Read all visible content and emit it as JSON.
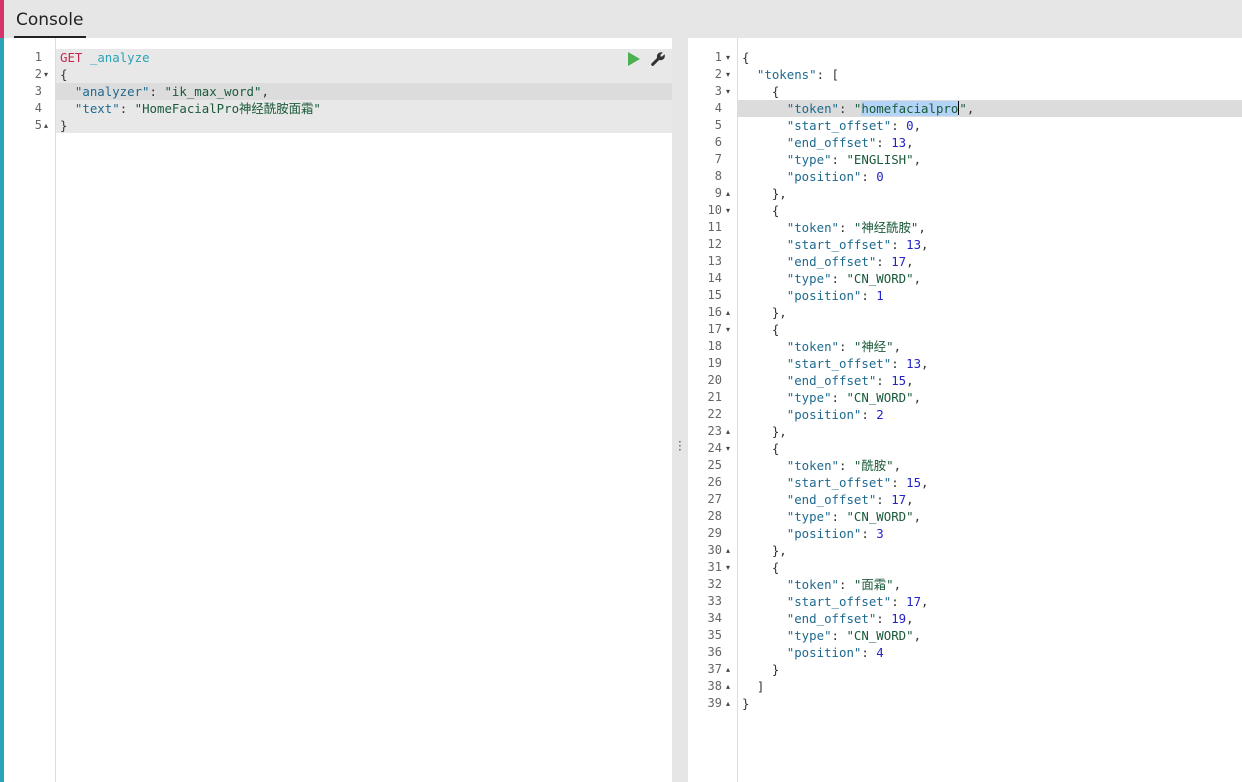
{
  "header": {
    "tab_label": "Console"
  },
  "colors": {
    "accent": "#2aa3b7",
    "method": "#c7254e",
    "play": "#4caf50"
  },
  "request": {
    "method": "GET",
    "endpoint": "_analyze",
    "line_numbers": [
      "1",
      "2",
      "3",
      "4",
      "5"
    ],
    "body": {
      "analyzer_key": "\"analyzer\"",
      "analyzer_value": "\"ik_max_word\"",
      "text_key": "\"text\"",
      "text_value": "\"HomeFacialPro神经酰胺面霜\""
    }
  },
  "response": {
    "line_numbers": [
      "1",
      "2",
      "3",
      "4",
      "5",
      "6",
      "7",
      "8",
      "9",
      "10",
      "11",
      "12",
      "13",
      "14",
      "15",
      "16",
      "17",
      "18",
      "19",
      "20",
      "21",
      "22",
      "23",
      "24",
      "25",
      "26",
      "27",
      "28",
      "29",
      "30",
      "31",
      "32",
      "33",
      "34",
      "35",
      "36",
      "37",
      "38",
      "39"
    ],
    "tokens_key": "\"tokens\"",
    "tokens": [
      {
        "token": "\"homefacialpro\"",
        "start_offset": "0",
        "end_offset": "13",
        "type": "\"ENGLISH\"",
        "position": "0"
      },
      {
        "token": "\"神经酰胺\"",
        "start_offset": "13",
        "end_offset": "17",
        "type": "\"CN_WORD\"",
        "position": "1"
      },
      {
        "token": "\"神经\"",
        "start_offset": "13",
        "end_offset": "15",
        "type": "\"CN_WORD\"",
        "position": "2"
      },
      {
        "token": "\"酰胺\"",
        "start_offset": "15",
        "end_offset": "17",
        "type": "\"CN_WORD\"",
        "position": "3"
      },
      {
        "token": "\"面霜\"",
        "start_offset": "17",
        "end_offset": "19",
        "type": "\"CN_WORD\"",
        "position": "4"
      }
    ],
    "keys": {
      "token": "\"token\"",
      "start_offset": "\"start_offset\"",
      "end_offset": "\"end_offset\"",
      "type": "\"type\"",
      "position": "\"position\""
    }
  },
  "icons": {
    "play": "play-icon",
    "wrench": "wrench-icon",
    "resize": "vertical-ellipsis-icon"
  }
}
